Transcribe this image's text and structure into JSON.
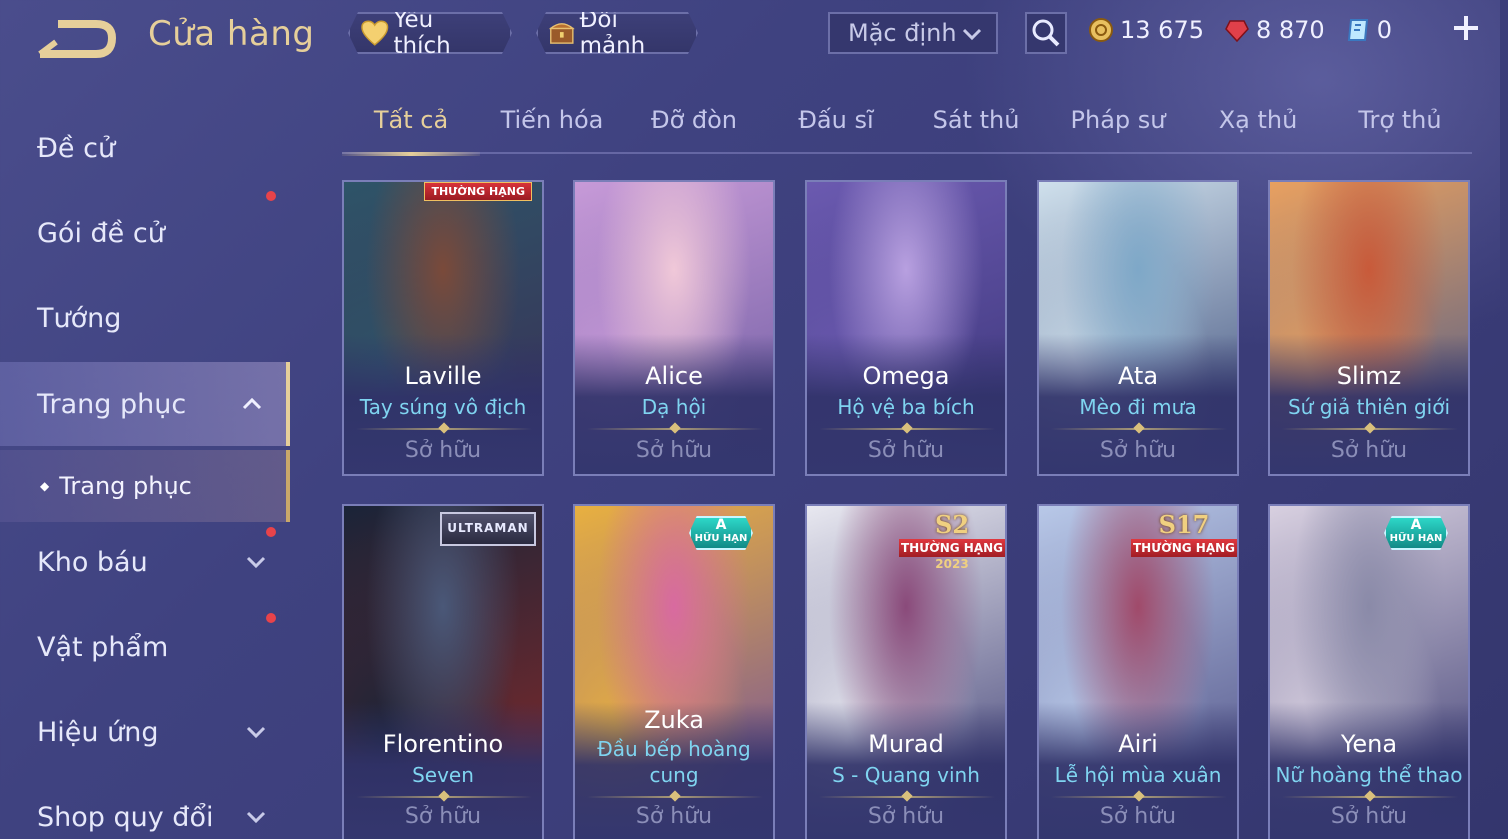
{
  "header": {
    "title": "Cửa hàng",
    "favorite_label": "Yêu thích",
    "exchange_label": "Đổi mảnh",
    "sort": {
      "selected": "Mặc định"
    },
    "currencies": [
      {
        "icon": "gold-coin-icon",
        "value": "13 675"
      },
      {
        "icon": "red-gem-icon",
        "value": "8 870"
      },
      {
        "icon": "blue-ticket-icon",
        "value": "0"
      }
    ]
  },
  "sidebar": {
    "items": [
      {
        "label": "Đề cử"
      },
      {
        "label": "Gói đề cử"
      },
      {
        "label": "Tướng"
      },
      {
        "label": "Trang phục"
      },
      {
        "label": "Kho báu"
      },
      {
        "label": "Vật phẩm"
      },
      {
        "label": "Hiệu ứng"
      },
      {
        "label": "Shop quy đổi"
      }
    ],
    "sub_item": "Trang phục"
  },
  "tabs": [
    "Tất cả",
    "Tiến hóa",
    "Đỡ đòn",
    "Đấu sĩ",
    "Sát thủ",
    "Pháp sư",
    "Xạ thủ",
    "Trợ thủ"
  ],
  "cards": [
    {
      "hero": "Laville",
      "skin": "Tay súng vô địch",
      "status": "Sở hữu",
      "badge": "THƯỜNG HẠNG",
      "colors": [
        "#2e5468",
        "#7a4a3a",
        "#3a2f55"
      ]
    },
    {
      "hero": "Alice",
      "skin": "Dạ hội",
      "status": "Sở hữu",
      "colors": [
        "#c79ad8",
        "#f0c8d8",
        "#6b5aa0"
      ]
    },
    {
      "hero": "Omega",
      "skin": "Hộ vệ ba bích",
      "status": "Sở hữu",
      "colors": [
        "#6b5ab0",
        "#b8a0e0",
        "#3a3478"
      ]
    },
    {
      "hero": "Ata",
      "skin": "Mèo đi mưa",
      "status": "Sở hữu",
      "colors": [
        "#cfe0ec",
        "#7ea8c8",
        "#3a4a78"
      ]
    },
    {
      "hero": "Slimz",
      "skin": "Sứ giả thiên giới",
      "status": "Sở hữu",
      "colors": [
        "#e8a060",
        "#c85a3a",
        "#4a5a8a"
      ]
    },
    {
      "hero": "Florentino",
      "skin": "Seven",
      "status": "Sở hữu",
      "badge": "ULTRAMAN",
      "colors": [
        "#1a2438",
        "#4a5878",
        "#8a2a2a"
      ]
    },
    {
      "hero": "Zuka",
      "skin": "Đầu bếp hoàng cung",
      "status": "Sở hữu",
      "badge_a": "A",
      "badge_sub": "HỮU HẠN",
      "colors": [
        "#e8b040",
        "#d86aa0",
        "#6a4aa0"
      ]
    },
    {
      "hero": "Murad",
      "skin": "S - Quang vinh",
      "status": "Sở hữu",
      "rank_big": "S2",
      "rank_strip": "THƯỜNG HẠNG",
      "rank_year": "2023",
      "colors": [
        "#e8e8f0",
        "#8a4a7a",
        "#3a3a70"
      ]
    },
    {
      "hero": "Airi",
      "skin": "Lễ hội mùa xuân",
      "status": "Sở hữu",
      "rank_big": "S17",
      "rank_strip": "THƯỜNG HẠNG",
      "colors": [
        "#b8c8e8",
        "#a04a6a",
        "#4a4a80"
      ]
    },
    {
      "hero": "Yena",
      "skin": "Nữ hoàng thể thao",
      "status": "Sở hữu",
      "badge_a": "A",
      "badge_sub": "HỮU HẠN",
      "colors": [
        "#d8d0e0",
        "#8a8aa8",
        "#3a3a70"
      ]
    }
  ]
}
